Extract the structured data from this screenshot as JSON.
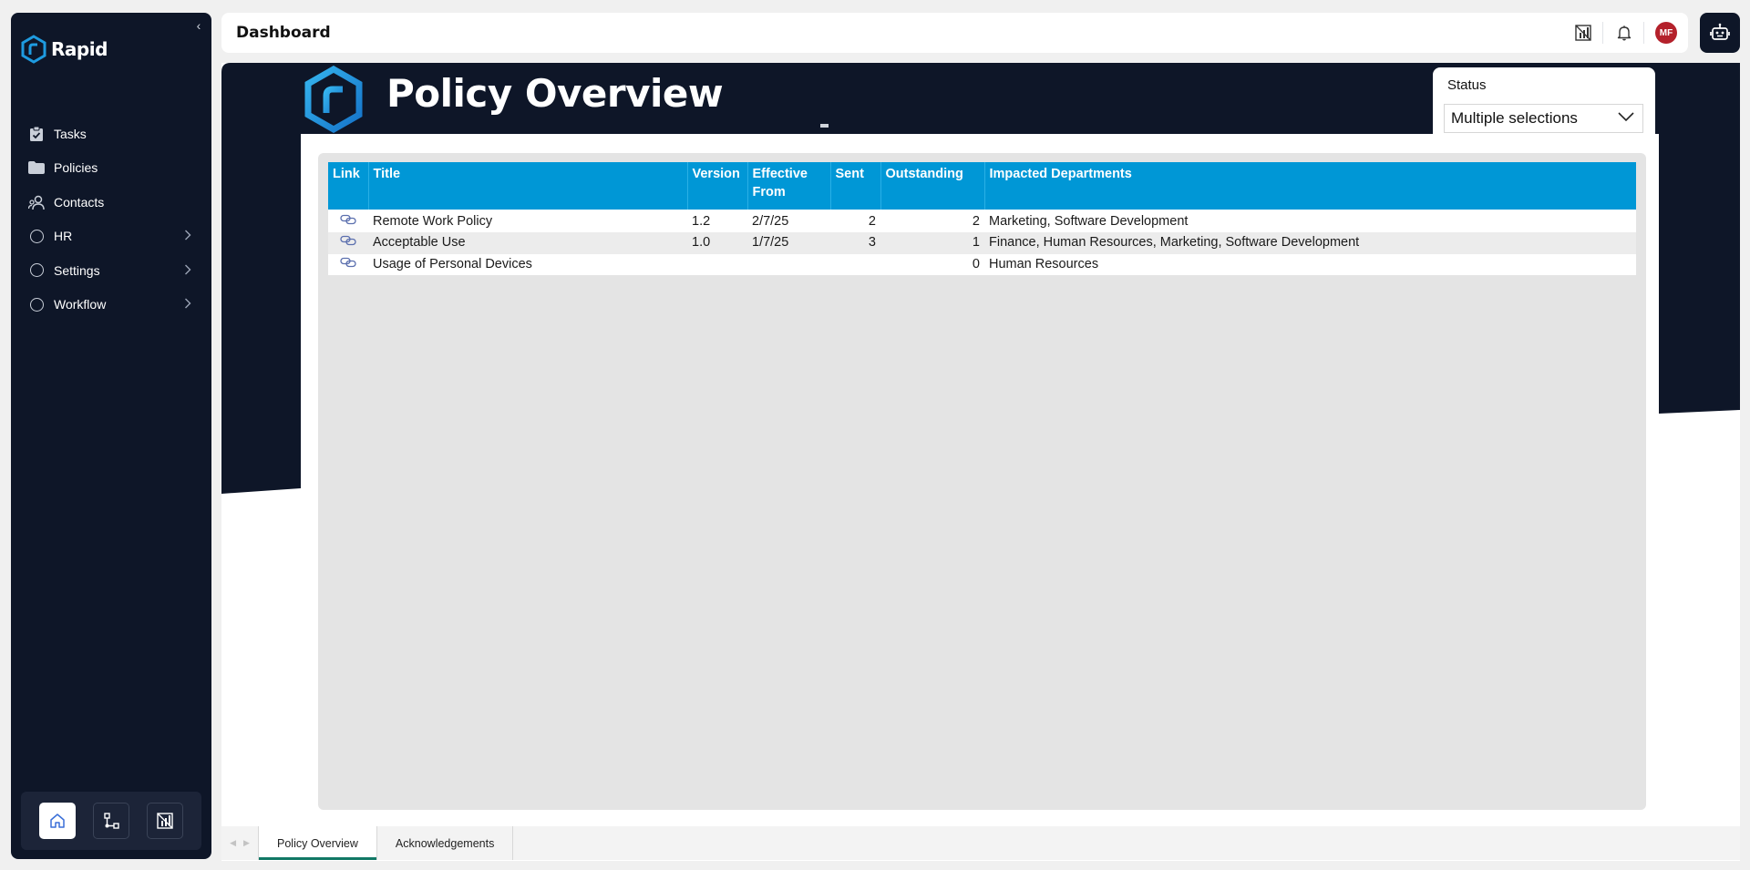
{
  "app": {
    "brand": "Rapid"
  },
  "sidebar": {
    "items": [
      {
        "label": "Tasks",
        "icon": "clipboard-check-icon"
      },
      {
        "label": "Policies",
        "icon": "folder-icon"
      },
      {
        "label": "Contacts",
        "icon": "contacts-icon"
      },
      {
        "label": "HR",
        "icon": "circle-icon",
        "has_children": true
      },
      {
        "label": "Settings",
        "icon": "circle-icon",
        "has_children": true
      },
      {
        "label": "Workflow",
        "icon": "circle-icon",
        "has_children": true
      }
    ],
    "footer": [
      "home-icon",
      "workflow-icon",
      "report-icon"
    ]
  },
  "topbar": {
    "title": "Dashboard",
    "avatar_initials": "MF"
  },
  "report": {
    "title": "Policy Overview",
    "slicer": {
      "label": "Status",
      "value": "Multiple selections"
    },
    "table": {
      "headers": {
        "link": "Link",
        "title": "Title",
        "version": "Version",
        "effective_1": "Effective",
        "effective_2": "From",
        "sent": "Sent",
        "outstanding": "Outstanding",
        "departments": "Impacted Departments"
      },
      "rows": [
        {
          "title": "Remote Work Policy",
          "version": "1.2",
          "effective": "2/7/25",
          "sent": "2",
          "outstanding": "2",
          "departments": "Marketing, Software Development"
        },
        {
          "title": "Acceptable Use",
          "version": "1.0",
          "effective": "1/7/25",
          "sent": "3",
          "outstanding": "1",
          "departments": "Finance, Human Resources, Marketing, Software Development"
        },
        {
          "title": "Usage of Personal Devices",
          "version": "",
          "effective": "",
          "sent": "",
          "outstanding": "0",
          "departments": "Human Resources"
        }
      ]
    }
  },
  "tabs": [
    "Policy Overview",
    "Acknowledgements"
  ],
  "colors": {
    "navy": "#0e1628",
    "header_blue": "#0097d6",
    "avatar_red": "#b4212b",
    "tab_underline": "#117865"
  }
}
